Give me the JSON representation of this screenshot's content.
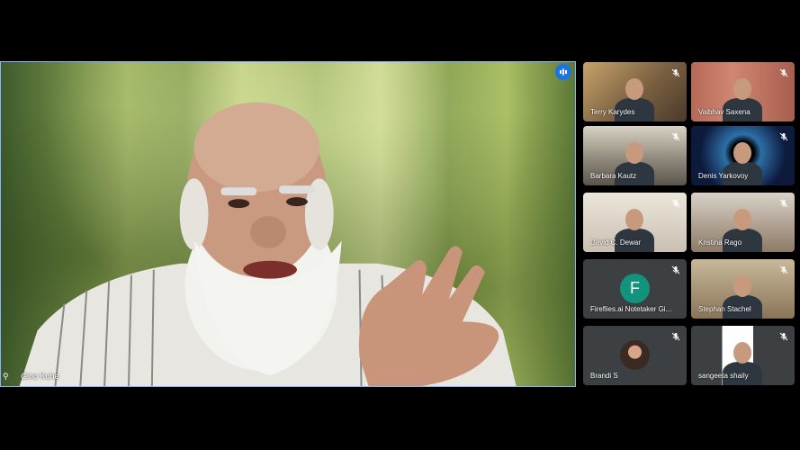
{
  "main": {
    "speaker_name": "Gino Kuhe",
    "speaking_indicator": "audio-active-icon"
  },
  "participants": [
    {
      "name": "Terry Karydes"
    },
    {
      "name": "Vaibhav Saxena"
    },
    {
      "name": "Barbara Kautz"
    },
    {
      "name": "Denis Yarkovoy"
    },
    {
      "name": "David C. Dewar"
    },
    {
      "name": "Kristina Rago"
    },
    {
      "name": "Fireflies.ai Notetaker Gi...",
      "avatar_letter": "F",
      "avatar_color": "#12937b"
    },
    {
      "name": "Stephan Stachel"
    },
    {
      "name": "Brandi S"
    },
    {
      "name": "sangeeta shaily"
    }
  ],
  "colors": {
    "accent": "#8ab4f8",
    "speaking": "#1a73e8",
    "tile_bg": "#3c4043"
  }
}
